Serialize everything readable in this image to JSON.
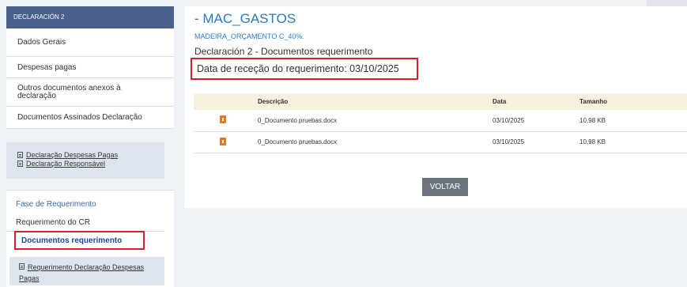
{
  "sidebar": {
    "header": "DECLARACIÓN 2",
    "items": [
      {
        "label": "Dados Gerais"
      },
      {
        "label": "Despesas pagas"
      },
      {
        "label": "Outros documentos anexos à declaração"
      },
      {
        "label": "Documentos Assinados Declaração"
      }
    ],
    "links": [
      {
        "label": "Declaração Despesas Pagas",
        "icon": "document-icon"
      },
      {
        "label": "Declaração Responsável",
        "icon": "document-icon"
      }
    ],
    "phase": {
      "title": "Fase de Requerimento",
      "items": [
        {
          "label": "Requerimento do CR"
        }
      ],
      "active": "Documentos requerimento",
      "sublink": "Requerimento Declaração Despesas Pagas",
      "sublink_icon": "document-icon"
    }
  },
  "main": {
    "title": "- MAC_GASTOS",
    "subtitle": "MADEIRA_ORÇAMENTO C_40%.",
    "declaration": "Declaración 2 - Documentos requerimento",
    "date_line": "Data de receção do requerimento: 03/10/2025",
    "table": {
      "headers": [
        "Descrição",
        "Data",
        "Tamanho"
      ],
      "rows": [
        {
          "name": "0_Documento pruebas.docx",
          "date": "03/10/2025",
          "size": "10,98 KB",
          "icon": "file-download-icon"
        },
        {
          "name": "0_Documento pruebas.docx",
          "date": "03/10/2025",
          "size": "10,98 KB",
          "icon": "file-download-icon"
        }
      ]
    },
    "back_button": "VOLTAR"
  },
  "colors": {
    "accent": "#2a79c4",
    "sidebar_header": "#4a5f8a",
    "highlight_border": "#d91f26",
    "active_link": "#1a47a6",
    "button": "#6c757d",
    "table_header": "#f6f0de",
    "file_icon": "#e07a1c"
  }
}
